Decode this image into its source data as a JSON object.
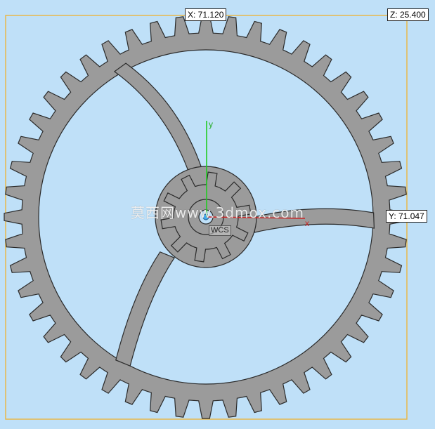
{
  "dimensions": {
    "x_label": "X: 71.120",
    "z_label": "Z: 25.400",
    "y_label": "Y: 71.047"
  },
  "axes": {
    "y_axis_label": "y",
    "x_axis_label": "x",
    "csys_label": "WCS"
  },
  "watermark": "莫西网www.3dmox.com",
  "colors": {
    "background": "#bfe0f8",
    "part_fill": "#9b9b9b",
    "edge": "#2a2a2a",
    "bounding_box": "#e8b84a",
    "y_axis": "#22cc22",
    "x_axis": "#cc2222"
  },
  "model": {
    "wheel_teeth": 48,
    "pinion_teeth": 10,
    "spokes": 3
  }
}
